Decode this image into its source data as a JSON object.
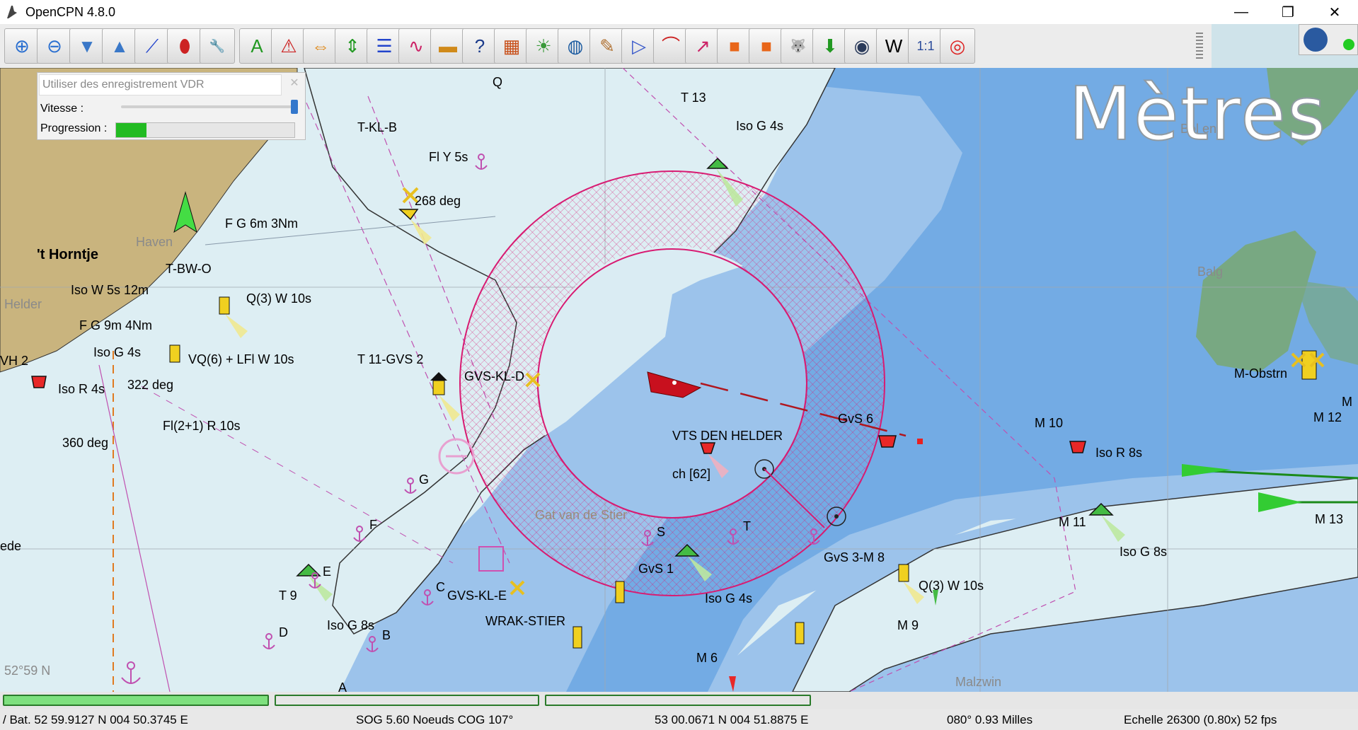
{
  "window": {
    "title": "OpenCPN 4.8.0",
    "minimize": "—",
    "maximize": "❐",
    "close": "✕"
  },
  "toolbar": {
    "tools": [
      {
        "icon": "zoom-in-icon",
        "glyph": "⊕",
        "color": "#2a6fd0"
      },
      {
        "icon": "zoom-out-icon",
        "glyph": "⊖",
        "color": "#2a6fd0"
      },
      {
        "icon": "scale-down-icon",
        "glyph": "▼",
        "color": "#3a78c8"
      },
      {
        "icon": "scale-up-icon",
        "glyph": "▲",
        "color": "#3a78c8"
      },
      {
        "icon": "route-icon",
        "glyph": "⟋",
        "color": "#2244cc"
      },
      {
        "icon": "boat-icon",
        "glyph": "⬮",
        "color": "#cc2222"
      },
      {
        "icon": "settings-icon",
        "glyph": "🔧",
        "color": "#666"
      },
      {
        "icon": "text-icon",
        "glyph": "A",
        "color": "#229922"
      },
      {
        "icon": "ais-icon",
        "glyph": "⚠",
        "color": "#cc2222"
      },
      {
        "icon": "tide-icon",
        "glyph": "⇔",
        "color": "#e08a1a"
      },
      {
        "icon": "current-icon",
        "glyph": "⇕",
        "color": "#229922"
      },
      {
        "icon": "route-manager-icon",
        "glyph": "☰",
        "color": "#2244cc"
      },
      {
        "icon": "track-icon",
        "glyph": "∿",
        "color": "#cc2266"
      },
      {
        "icon": "depth-icon",
        "glyph": "▬",
        "color": "#d08a1a"
      },
      {
        "icon": "help-icon",
        "glyph": "?",
        "color": "#1a3a8a"
      },
      {
        "icon": "grib-icon",
        "glyph": "▦",
        "color": "#c8501a"
      },
      {
        "icon": "weather-icon",
        "glyph": "☀",
        "color": "#3a9a3a"
      },
      {
        "icon": "globe-icon",
        "glyph": "◍",
        "color": "#1a5aa0"
      },
      {
        "icon": "logbook-icon",
        "glyph": "✎",
        "color": "#b07030"
      },
      {
        "icon": "dashboard-icon",
        "glyph": "▷",
        "color": "#3a5aca"
      },
      {
        "icon": "drop-icon",
        "glyph": "⌒",
        "color": "#cc2222"
      },
      {
        "icon": "performance-icon",
        "glyph": "↗",
        "color": "#cc2266"
      },
      {
        "icon": "mark-icon",
        "glyph": "■",
        "color": "#e8661a"
      },
      {
        "icon": "mark-alt-icon",
        "glyph": "■",
        "color": "#e8661a"
      },
      {
        "icon": "husky-icon",
        "glyph": "🐺",
        "color": "#333"
      },
      {
        "icon": "download-icon",
        "glyph": "⬇",
        "color": "#229922"
      },
      {
        "icon": "radar-icon",
        "glyph": "◉",
        "color": "#2a3a5a"
      },
      {
        "icon": "wmm-icon",
        "glyph": "W",
        "color": "#000"
      },
      {
        "icon": "scale-icon",
        "glyph": "1:1",
        "color": "#2a4a9a"
      },
      {
        "icon": "lifering-icon",
        "glyph": "◎",
        "color": "#dd2222"
      }
    ]
  },
  "vdr": {
    "title": "Utiliser des enregistrement VDR",
    "speed_label": "Vitesse :",
    "progress_label": "Progression :",
    "speed_value": 1.0,
    "progress_value": 0.17
  },
  "chart": {
    "unit_watermark": "Mètres",
    "labels": [
      "Q",
      "T 13",
      "Iso G 4s",
      "T-KL-B",
      "Fl Y 5s",
      "268 deg",
      "F G 6m 3Nm",
      "'t Horntje",
      "T-BW-O",
      "Iso W 5s 12m",
      "Q(3) W 10s",
      "F G 9m 4Nm",
      "Iso G 4s",
      "VQ(6) + LFl W 10s",
      "T 11-GVS 2",
      "GVS-KL-D",
      "VH 2",
      "Iso R 4s",
      "322 deg",
      "Fl(2+1) R 10s",
      "360 deg",
      "VTS DEN HELDER",
      "ch [62]",
      "GvS 6",
      "M 10",
      "Iso R 8s",
      "M-Obstrn",
      "M 12",
      "G",
      "M 11",
      "Iso G 8s",
      "M 13",
      "F",
      "Gat van de Stier",
      "S",
      "T",
      "GvS 3-M 8",
      "E",
      "GvS 1",
      "T 9",
      "C",
      "GVS-KL-E",
      "Iso G 4s",
      "Q(3) W 10s",
      "D",
      "Iso G 8s",
      "B",
      "WRAK-STIER",
      "M 9",
      "M 6",
      "A",
      "Balg",
      "Bol en",
      "Malzwin",
      "52°59 N",
      "ede",
      "M",
      "Haven",
      "Helder"
    ]
  },
  "status": {
    "position": "/ Bat. 52 59.9127 N   004 50.3745 E",
    "sog_cog": "SOG 5.60 Noeuds  COG 107°",
    "cursor": "53 00.0671 N   004 51.8875 E",
    "bearing": "080°  0.93 Milles",
    "scale": "Echelle 26300 (0.80x)   52 fps"
  },
  "colors": {
    "land": "#c9b47e",
    "shallow": "#9cc3eb",
    "deep": "#ddeef3",
    "mid": "#6fa8e3",
    "wetland": "#78a882",
    "guard_zone": "#d81b72",
    "toolbar_bg": "#ececec"
  }
}
